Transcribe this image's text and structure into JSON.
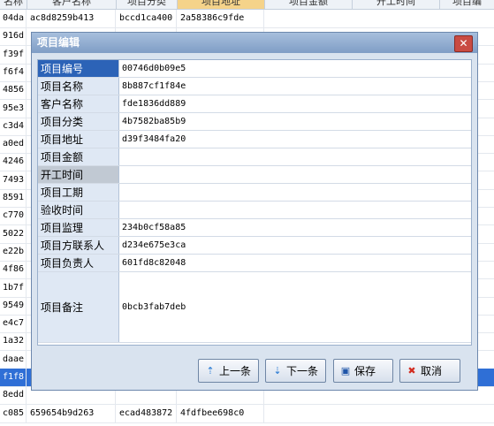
{
  "grid": {
    "headers": [
      "名称",
      "客户名称",
      "项目分类",
      "项目地址",
      "项目金额",
      "开工时间",
      "项目编"
    ],
    "active_header_index": 3,
    "rows": [
      [
        "04da",
        "ac8d8259b413",
        "bccd1ca400",
        "2a58386c9fde"
      ],
      [
        "916d",
        "",
        "",
        ""
      ],
      [
        "f39f",
        "",
        "",
        ""
      ],
      [
        "f6f4",
        "",
        "",
        ""
      ],
      [
        "4856",
        "",
        "",
        ""
      ],
      [
        "95e3",
        "",
        "",
        ""
      ],
      [
        "c3d4",
        "",
        "",
        ""
      ],
      [
        "a0ed",
        "",
        "",
        ""
      ],
      [
        "4246",
        "",
        "",
        ""
      ],
      [
        "7493",
        "",
        "",
        ""
      ],
      [
        "8591",
        "",
        "",
        ""
      ],
      [
        "c770",
        "",
        "",
        ""
      ],
      [
        "5022",
        "",
        "",
        ""
      ],
      [
        "e22b",
        "",
        "",
        ""
      ],
      [
        "4f86",
        "",
        "",
        ""
      ],
      [
        "1b7f",
        "",
        "",
        ""
      ],
      [
        "9549",
        "",
        "",
        ""
      ],
      [
        "e4c7",
        "",
        "",
        ""
      ],
      [
        "1a32",
        "",
        "",
        ""
      ],
      [
        "daae",
        "",
        "",
        ""
      ],
      [
        "f1f8",
        "",
        "",
        ""
      ],
      [
        "8edd",
        "",
        "",
        ""
      ],
      [
        "c085",
        "659654b9d263",
        "ecad483872",
        "4fdfbee698c0"
      ]
    ],
    "selected_row_index": 20
  },
  "dialog": {
    "title": "项目编辑",
    "close_glyph": "✕",
    "fields": [
      {
        "label": "项目编号",
        "value": "00746d0b09e5"
      },
      {
        "label": "项目名称",
        "value": "8b887cf1f84e"
      },
      {
        "label": "客户名称",
        "value": "fde1836dd889"
      },
      {
        "label": "项目分类",
        "value": "4b7582ba85b9"
      },
      {
        "label": "项目地址",
        "value": "d39f3484fa20"
      },
      {
        "label": "项目金额",
        "value": ""
      },
      {
        "label": "开工时间",
        "value": ""
      },
      {
        "label": "项目工期",
        "value": ""
      },
      {
        "label": "验收时间",
        "value": ""
      },
      {
        "label": "项目监理",
        "value": "234b0cf58a85"
      },
      {
        "label": "项目方联系人",
        "value": "d234e675e3ca"
      },
      {
        "label": "项目负责人",
        "value": "601fd8c82048"
      },
      {
        "label": "项目备注",
        "value": "0bcb3fab7deb"
      }
    ],
    "active_field_index": 0,
    "gray_field_index": 6,
    "buttons": {
      "prev": {
        "label": "上一条",
        "icon": "prev-record-icon",
        "glyph": "⇡"
      },
      "next": {
        "label": "下一条",
        "icon": "next-record-icon",
        "glyph": "⇣"
      },
      "save": {
        "label": "保存",
        "icon": "save-disk-icon",
        "glyph": "▣"
      },
      "cancel": {
        "label": "取消",
        "icon": "cancel-x-icon",
        "glyph": "✖"
      }
    }
  }
}
